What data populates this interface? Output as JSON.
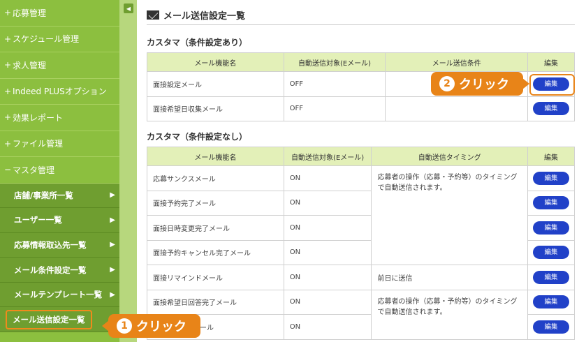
{
  "sidebar": {
    "items": [
      {
        "prefix": "+",
        "label": "応募管理"
      },
      {
        "prefix": "+",
        "label": "スケジュール管理"
      },
      {
        "prefix": "+",
        "label": "求人管理"
      },
      {
        "prefix": "+",
        "label": "Indeed PLUSオプション"
      },
      {
        "prefix": "+",
        "label": "効果レポート"
      },
      {
        "prefix": "+",
        "label": "ファイル管理"
      },
      {
        "prefix": "−",
        "label": "マスタ管理"
      }
    ],
    "sub_items": [
      {
        "label": "店舗/事業所一覧"
      },
      {
        "label": "ユーザー一覧"
      },
      {
        "label": "応募情報取込先一覧"
      },
      {
        "label": "メール条件設定一覧"
      },
      {
        "label": "メールテンプレート一覧"
      },
      {
        "label": "メール送信設定一覧"
      }
    ]
  },
  "main": {
    "title": "メール送信設定一覧",
    "section1": {
      "title": "カスタマ（条件設定あり）",
      "headers": [
        "メール機能名",
        "自動送信対象(Eメール)",
        "メール送信条件",
        "編集"
      ],
      "rows": [
        {
          "name": "面接設定メール",
          "auto": "OFF",
          "condition": ""
        },
        {
          "name": "面接希望日収集メール",
          "auto": "OFF",
          "condition": ""
        }
      ]
    },
    "section2": {
      "title": "カスタマ（条件設定なし）",
      "headers": [
        "メール機能名",
        "自動送信対象(Eメール)",
        "自動送信タイミング",
        "編集"
      ],
      "rows": [
        {
          "name": "応募サンクスメール",
          "auto": "ON"
        },
        {
          "name": "面接予約完了メール",
          "auto": "ON"
        },
        {
          "name": "面接日時変更完了メール",
          "auto": "ON"
        },
        {
          "name": "面接予約キャンセル完了メール",
          "auto": "ON"
        },
        {
          "name": "面接リマインドメール",
          "auto": "ON"
        },
        {
          "name": "面接希望日回答完了メール",
          "auto": "ON"
        },
        {
          "name": "ール",
          "auto": "ON"
        }
      ],
      "timing_a": "応募者の操作（応募・予約等）のタイミングで自動送信されます。",
      "timing_b": "前日に送信",
      "timing_c": "応募者の操作（応募・予約等）のタイミングで自動送信されます。"
    },
    "edit_label": "編集"
  },
  "callouts": {
    "one": {
      "num": "1",
      "text": "クリック"
    },
    "two": {
      "num": "2",
      "text": "クリック"
    }
  },
  "colors": {
    "sidebar": "#8cbf3f",
    "accent": "#e88418",
    "button": "#2141c8",
    "header_bg": "#e3f0b8"
  }
}
